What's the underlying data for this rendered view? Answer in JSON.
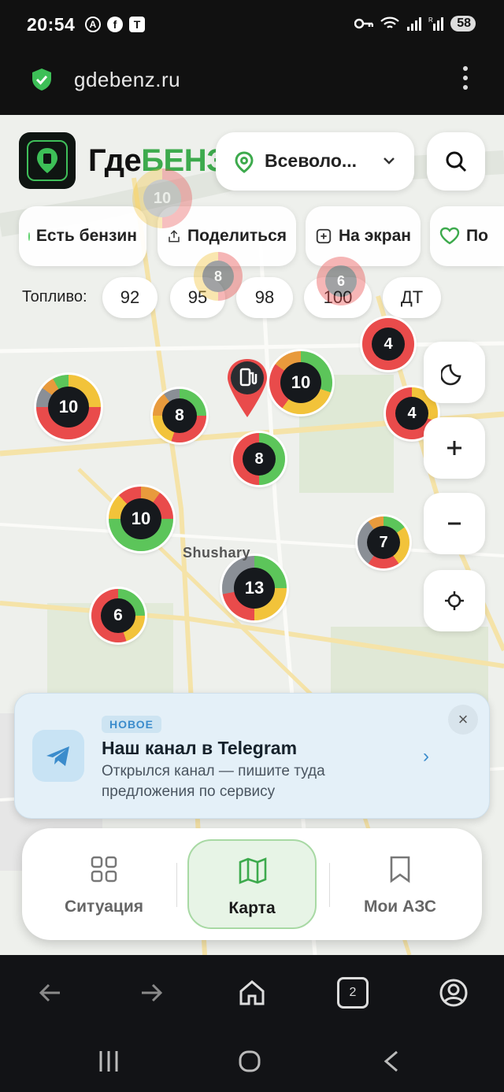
{
  "status_bar": {
    "time": "20:54",
    "battery": "58",
    "icons": [
      "anarchy-icon",
      "facebook-icon",
      "tutu-icon",
      "key-icon",
      "wifi-icon",
      "signal-icon",
      "signal-r-icon"
    ]
  },
  "browser": {
    "url": "gdebenz.ru",
    "tab_count": "2"
  },
  "app": {
    "brand_prefix": "Где",
    "brand_highlight": "БЕНЗ",
    "region": "Всеволо...",
    "chips": [
      "Есть бензин",
      "Поделиться",
      "На экран",
      "По"
    ],
    "fuel_label": "Топливо:",
    "fuel_types": [
      "92",
      "95",
      "98",
      "100",
      "ДТ"
    ]
  },
  "map": {
    "place_label": "Shushary",
    "clusters": [
      "10",
      "8",
      "10",
      "8",
      "4",
      "4",
      "10",
      "7",
      "13",
      "6",
      "10",
      "6",
      "8"
    ]
  },
  "promo": {
    "badge": "НОВОЕ",
    "title": "Наш канал в Telegram",
    "description": "Открылся канал — пишите туда предложения по сервису"
  },
  "tabs": [
    {
      "label": "Ситуация",
      "icon": "grid-icon",
      "active": false
    },
    {
      "label": "Карта",
      "icon": "map-icon",
      "active": true
    },
    {
      "label": "Мои АЗС",
      "icon": "bookmark-icon",
      "active": false
    }
  ],
  "colors": {
    "accent_green": "#3daa4d",
    "cluster_red": "#e94b4b",
    "cluster_yellow": "#f2c33a",
    "cluster_green": "#5cc55a",
    "cluster_gray": "#8a8f96",
    "cluster_orange": "#e89a3c",
    "telegram_blue": "#3b8ccc"
  }
}
